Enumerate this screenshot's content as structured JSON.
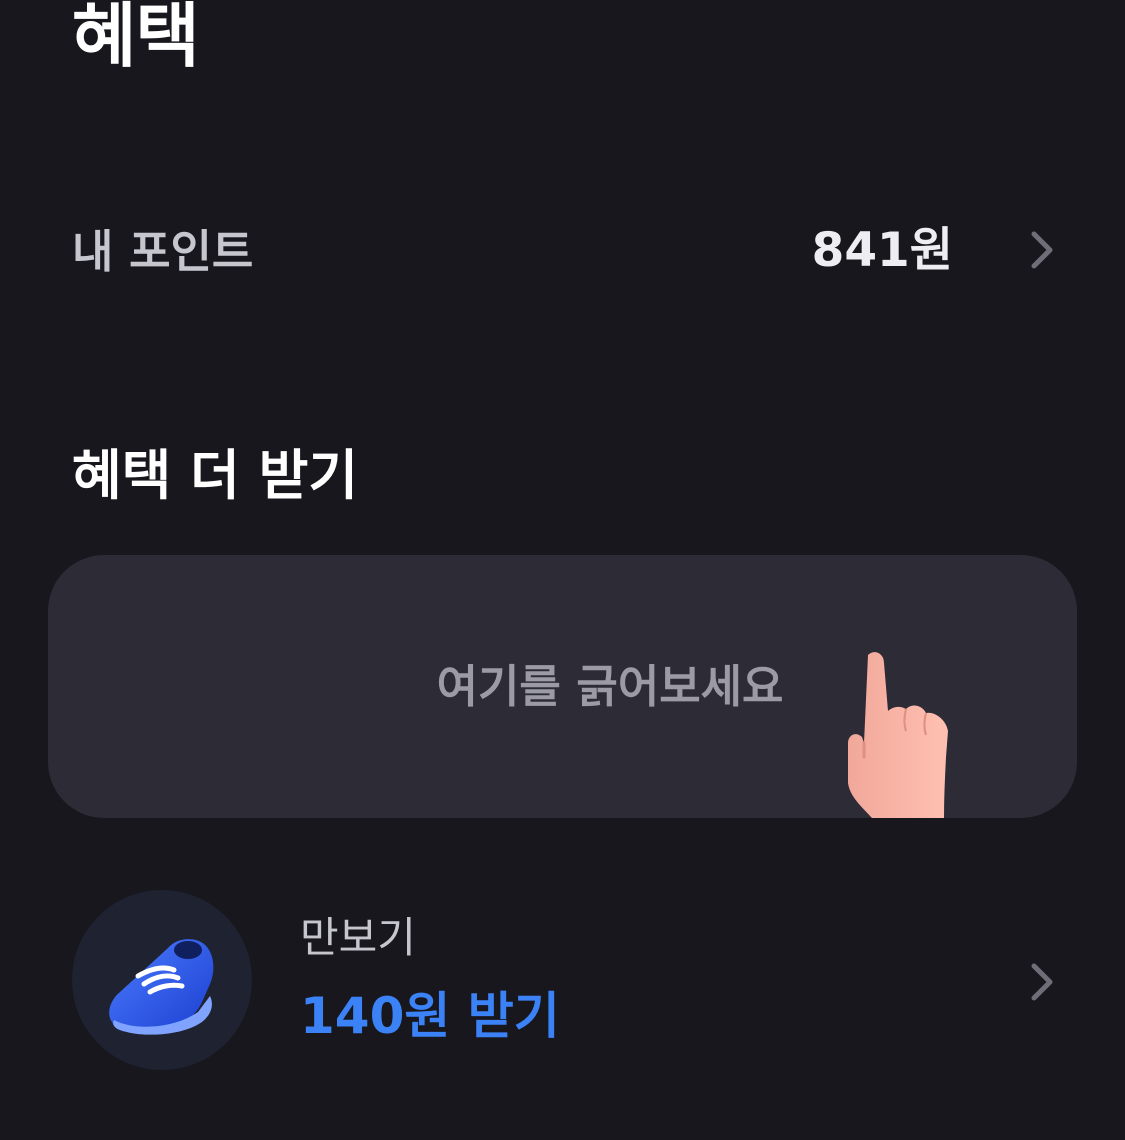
{
  "header": {
    "title": "혜택"
  },
  "points": {
    "label": "내 포인트",
    "value": "841원"
  },
  "more_benefits": {
    "title": "혜택 더 받기",
    "scratch_card": {
      "label": "여기를 긁어보세요",
      "icon": "pointing-hand-icon"
    }
  },
  "pedometer": {
    "title": "만보기",
    "reward": "140원 받기",
    "icon": "sneaker-icon",
    "reward_color": "#3b82f6"
  },
  "colors": {
    "background": "#18171e",
    "card": "#2c2b36",
    "accent": "#3b82f6"
  }
}
